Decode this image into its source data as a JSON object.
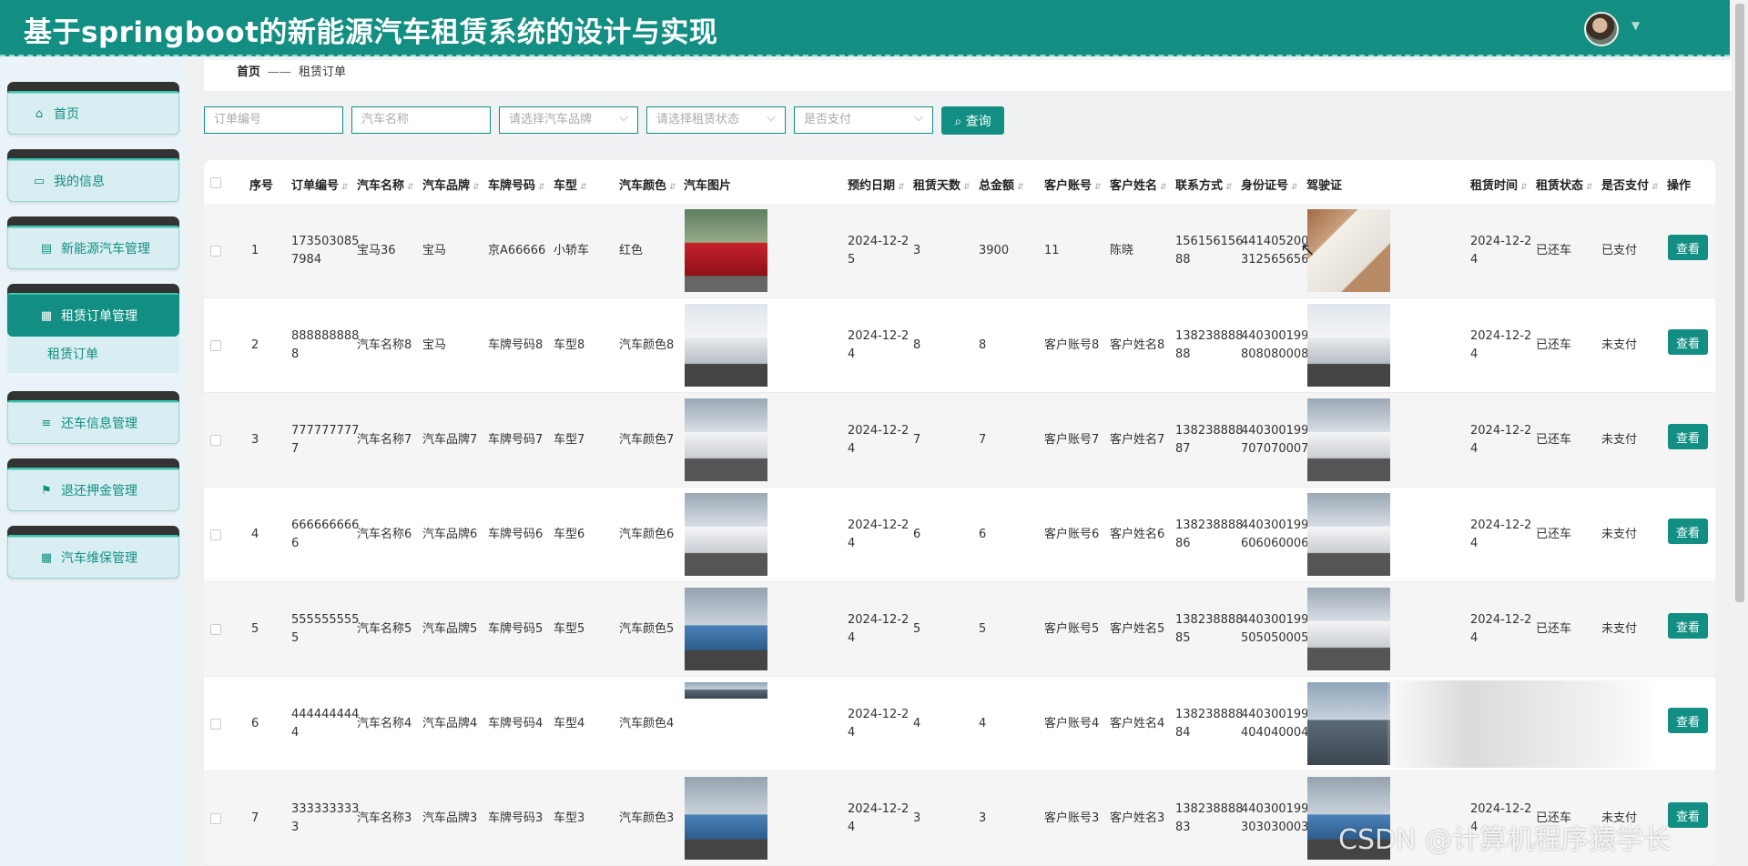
{
  "app": {
    "title": "基于springboot的新能源汽车租赁系统的设计与实现"
  },
  "header": {
    "avatar_icon": "user-avatar",
    "caret_icon": "caret-down-icon"
  },
  "sidebar": {
    "items": [
      {
        "label": "首页",
        "icon": "home-icon"
      },
      {
        "label": "我的信息",
        "icon": "id-card-icon"
      },
      {
        "label": "新能源汽车管理",
        "icon": "clipboard-icon"
      },
      {
        "label": "租赁订单管理",
        "icon": "grid-icon"
      },
      {
        "label": "还车信息管理",
        "icon": "list-icon"
      },
      {
        "label": "退还押金管理",
        "icon": "flag-icon"
      },
      {
        "label": "汽车维保管理",
        "icon": "grid-icon"
      }
    ],
    "submenu": {
      "label": "租赁订单"
    }
  },
  "breadcrumb": {
    "home": "首页",
    "separator": "——",
    "current": "租赁订单"
  },
  "filters": {
    "order_no": {
      "placeholder": "订单编号"
    },
    "car_name": {
      "placeholder": "汽车名称"
    },
    "brand": {
      "placeholder": "请选择汽车品牌"
    },
    "status": {
      "placeholder": "请选择租赁状态"
    },
    "paid": {
      "placeholder": "是否支付"
    },
    "search_label": "查询"
  },
  "table": {
    "columns": [
      "序号",
      "订单编号",
      "汽车名称",
      "汽车品牌",
      "车牌号码",
      "车型",
      "汽车颜色",
      "汽车图片",
      "预约日期",
      "租赁天数",
      "总金额",
      "客户账号",
      "客户姓名",
      "联系方式",
      "身份证号",
      "驾驶证",
      "租赁时间",
      "租赁状态",
      "是否支付",
      "操作"
    ],
    "action_label": "查看",
    "rows": [
      {
        "index": "1",
        "order_no": "173503085\n7984",
        "car_name": "宝马36",
        "brand": "宝马",
        "plate": "京A66666",
        "model": "小轿车",
        "color": "红色",
        "date": "2024-12-2\n5",
        "days": "3",
        "amount": "3900",
        "account": "11",
        "customer": "陈晓",
        "phone": "156156156\n88",
        "id_no": "441405200\n312565656",
        "rent_time": "2024-12-2\n4",
        "status": "已还车",
        "paid": "已支付"
      },
      {
        "index": "2",
        "order_no": "888888888\n8",
        "car_name": "汽车名称8",
        "brand": "宝马",
        "plate": "车牌号码8",
        "model": "车型8",
        "color": "汽车颜色8",
        "date": "2024-12-2\n4",
        "days": "8",
        "amount": "8",
        "account": "客户账号8",
        "customer": "客户姓名8",
        "phone": "138238888\n88",
        "id_no": "440300199\n808080008",
        "rent_time": "2024-12-2\n4",
        "status": "已还车",
        "paid": "未支付"
      },
      {
        "index": "3",
        "order_no": "777777777\n7",
        "car_name": "汽车名称7",
        "brand": "汽车品牌7",
        "plate": "车牌号码7",
        "model": "车型7",
        "color": "汽车颜色7",
        "date": "2024-12-2\n4",
        "days": "7",
        "amount": "7",
        "account": "客户账号7",
        "customer": "客户姓名7",
        "phone": "138238888\n87",
        "id_no": "440300199\n707070007",
        "rent_time": "2024-12-2\n4",
        "status": "已还车",
        "paid": "未支付"
      },
      {
        "index": "4",
        "order_no": "666666666\n6",
        "car_name": "汽车名称6",
        "brand": "汽车品牌6",
        "plate": "车牌号码6",
        "model": "车型6",
        "color": "汽车颜色6",
        "date": "2024-12-2\n4",
        "days": "6",
        "amount": "6",
        "account": "客户账号6",
        "customer": "客户姓名6",
        "phone": "138238888\n86",
        "id_no": "440300199\n606060006",
        "rent_time": "2024-12-2\n4",
        "status": "已还车",
        "paid": "未支付"
      },
      {
        "index": "5",
        "order_no": "555555555\n5",
        "car_name": "汽车名称5",
        "brand": "汽车品牌5",
        "plate": "车牌号码5",
        "model": "车型5",
        "color": "汽车颜色5",
        "date": "2024-12-2\n4",
        "days": "5",
        "amount": "5",
        "account": "客户账号5",
        "customer": "客户姓名5",
        "phone": "138238888\n85",
        "id_no": "440300199\n505050005",
        "rent_time": "2024-12-2\n4",
        "status": "已还车",
        "paid": "未支付"
      },
      {
        "index": "6",
        "order_no": "444444444\n4",
        "car_name": "汽车名称4",
        "brand": "汽车品牌4",
        "plate": "车牌号码4",
        "model": "车型4",
        "color": "汽车颜色4",
        "date": "2024-12-2\n4",
        "days": "4",
        "amount": "4",
        "account": "客户账号4",
        "customer": "客户姓名4",
        "phone": "138238888\n84",
        "id_no": "440300199\n404040004",
        "rent_time": "",
        "status": "",
        "paid": ""
      },
      {
        "index": "7",
        "order_no": "333333333\n3",
        "car_name": "汽车名称3",
        "brand": "汽车品牌3",
        "plate": "车牌号码3",
        "model": "车型3",
        "color": "汽车颜色3",
        "date": "2024-12-2\n4",
        "days": "3",
        "amount": "3",
        "account": "客户账号3",
        "customer": "客户姓名3",
        "phone": "138238888\n83",
        "id_no": "440300199\n303030003",
        "rent_time": "2024-12-2\n4",
        "status": "已还车",
        "paid": "未支付"
      }
    ]
  },
  "watermark": {
    "text": "CSDN @计算机程序猿学长"
  },
  "colors": {
    "accent": "#128f82",
    "sidebar_bg": "#eaf3f7",
    "row_alt": "#f5f5f5"
  }
}
